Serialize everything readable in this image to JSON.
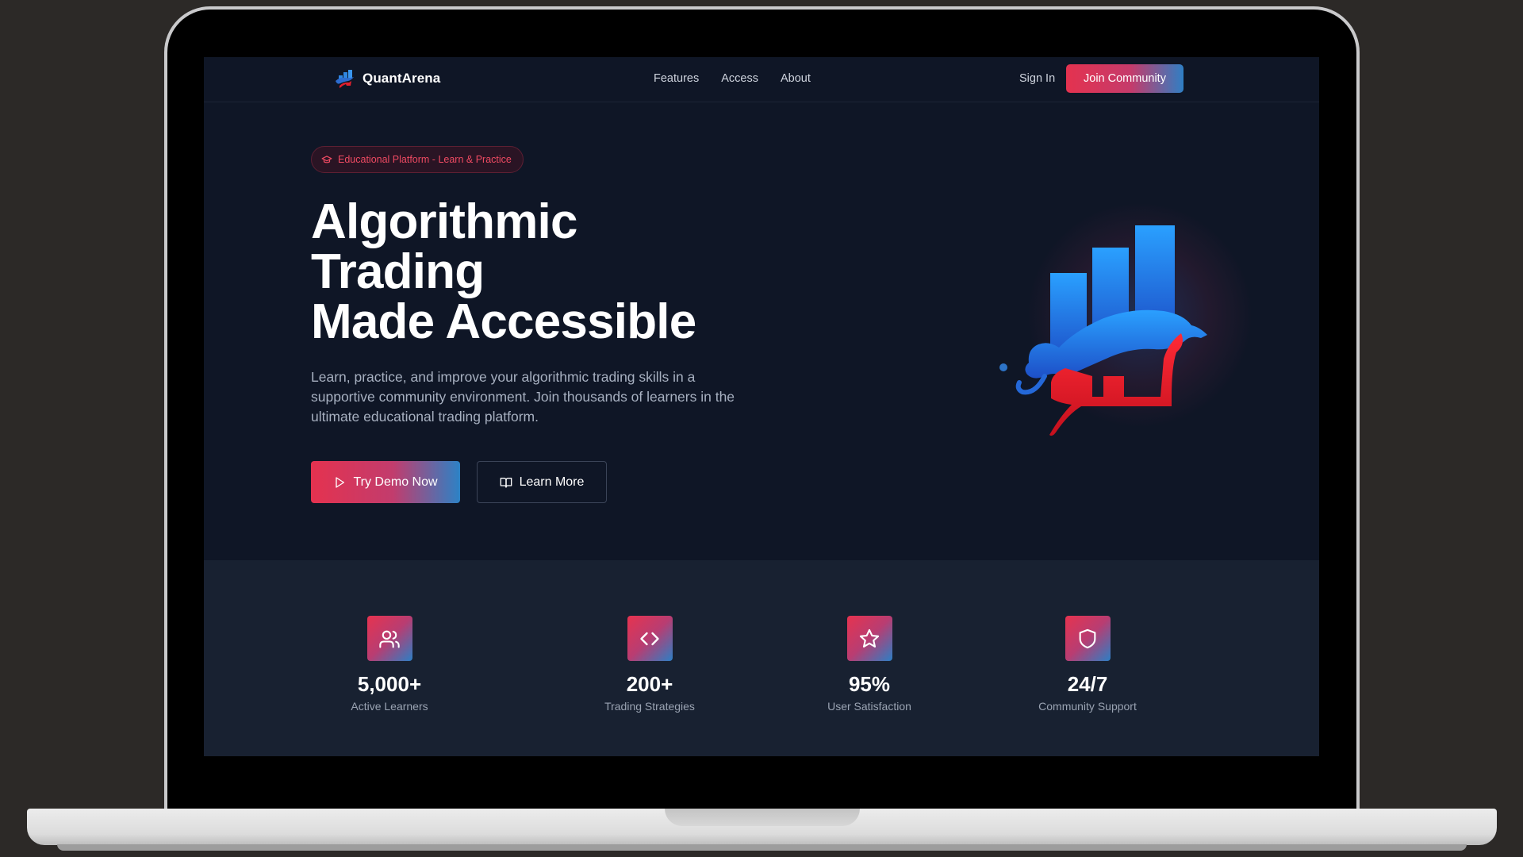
{
  "brand": {
    "name": "QuantArena"
  },
  "nav": {
    "links": [
      "Features",
      "Access",
      "About"
    ],
    "sign_in": "Sign In",
    "join": "Join Community"
  },
  "hero": {
    "badge": "Educational Platform - Learn & Practice",
    "title_lines": [
      "Algorithmic",
      "Trading",
      "Made Accessible"
    ],
    "description": "Learn, practice, and improve your algorithmic trading skills in a supportive community environment. Join thousands of learners in the ultimate educational trading platform.",
    "primary_cta": "Try Demo Now",
    "secondary_cta": "Learn More"
  },
  "stats": [
    {
      "icon": "users-icon",
      "value": "5,000+",
      "label": "Active Learners"
    },
    {
      "icon": "code-icon",
      "value": "200+",
      "label": "Trading Strategies"
    },
    {
      "icon": "star-icon",
      "value": "95%",
      "label": "User Satisfaction"
    },
    {
      "icon": "shield-icon",
      "value": "24/7",
      "label": "Community Support"
    }
  ],
  "colors": {
    "page_background": "#2c2927",
    "screen_background": "#0f1626",
    "stats_background": "#182131",
    "accent_red": "#e4324f",
    "accent_blue": "#2c82c6",
    "badge_text": "#ef4a62"
  }
}
